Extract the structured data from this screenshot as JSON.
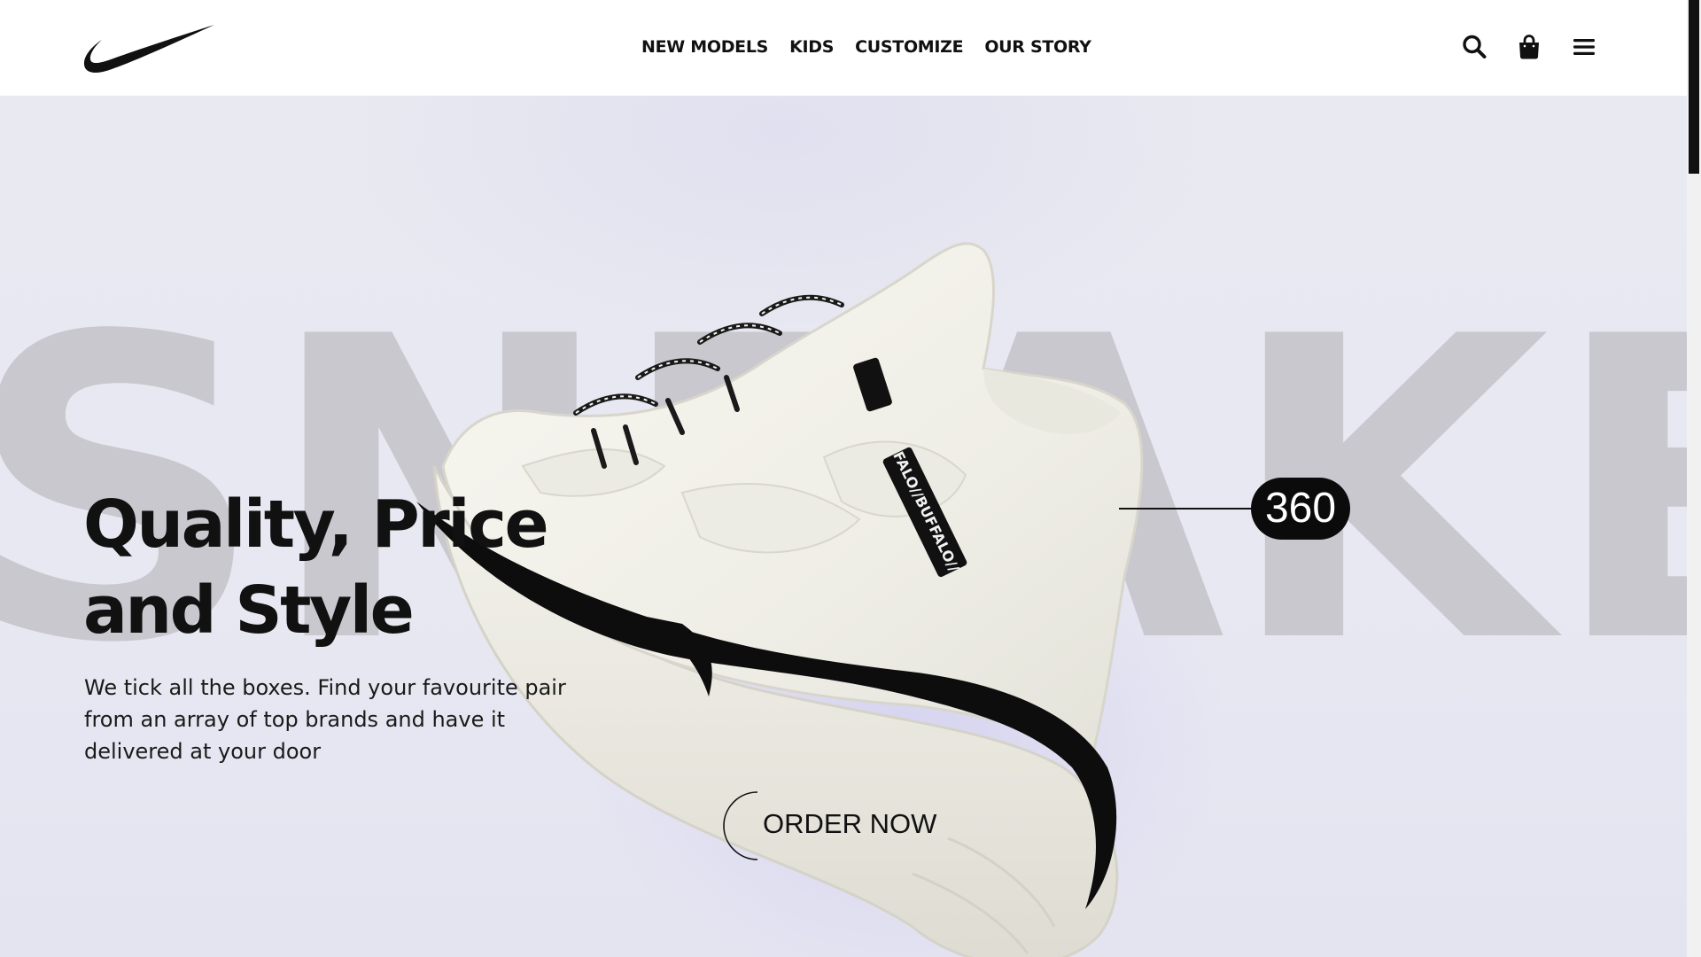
{
  "header": {
    "logo": "swoosh-logo",
    "nav": [
      {
        "label": "NEW MODELS"
      },
      {
        "label": "KIDS"
      },
      {
        "label": "CUSTOMIZE"
      },
      {
        "label": "OUR STORY"
      }
    ],
    "icons": [
      "search-icon",
      "shopping-bag-icon",
      "menu-icon"
    ]
  },
  "hero": {
    "background_word": "SNEAKERS",
    "headline_line1": "Quality, Price",
    "headline_line2": "and Style",
    "subtext": "We tick all the boxes. Find your favourite pair from an array of top brands and have it delivered at your door",
    "badge_360": "360",
    "order_button": "ORDER NOW",
    "product_image": "white-sneaker-with-black-stripe",
    "tag_text": "FALO//BUFFALO//"
  },
  "colors": {
    "text": "#111111",
    "hero_bg": "#e8e8f2",
    "watermark": "#c8c8ce",
    "badge_bg": "#0b0b0b",
    "badge_text": "#ffffff"
  }
}
